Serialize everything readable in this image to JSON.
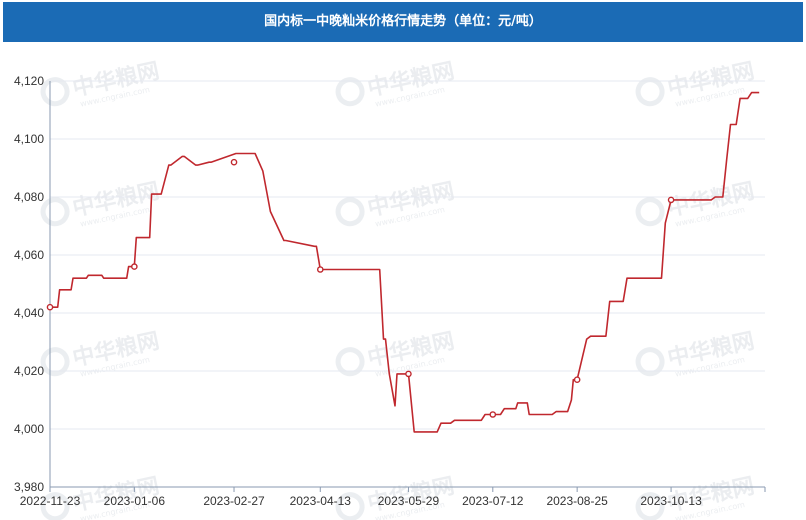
{
  "header": {
    "title": "国内标一中晚籼米价格行情走势（单位：元/吨）"
  },
  "watermark": {
    "brand": "中华粮网",
    "site": "www.cngrain.com"
  },
  "colors": {
    "header_bg": "#1b6bb5",
    "line": "#c0282e",
    "grid": "#e4e8f0",
    "axis": "#8a9ab0"
  },
  "chart_data": {
    "type": "line",
    "title": "国内标一中晚籼米价格行情走势（单位：元/吨）",
    "xlabel": "",
    "ylabel": "",
    "xlim": [
      "2022-11-23",
      "2023-12-01"
    ],
    "ylim": [
      3980,
      4120
    ],
    "yticks": [
      3980,
      4000,
      4020,
      4040,
      4060,
      4080,
      4100,
      4120
    ],
    "yticks_label": [
      "3,980",
      "4,000",
      "4,020",
      "4,040",
      "4,060",
      "4,080",
      "4,100",
      "4,120"
    ],
    "xticks": [
      "2022-11-23",
      "2023-01-06",
      "2023-02-27",
      "2023-04-13",
      "2023-05-29",
      "2023-07-12",
      "2023-08-25",
      "2023-10-13"
    ],
    "grid": "horizontal",
    "series": [
      {
        "name": "",
        "x": [
          "2022-11-23",
          "2022-11-27",
          "2022-11-28",
          "2022-12-04",
          "2022-12-05",
          "2022-12-12",
          "2022-12-13",
          "2022-12-20",
          "2022-12-21",
          "2023-01-02",
          "2023-01-03",
          "2023-01-05",
          "2023-01-06",
          "2023-01-07",
          "2023-01-14",
          "2023-01-15",
          "2023-01-20",
          "2023-01-24",
          "2023-01-25",
          "2023-01-31",
          "2023-02-01",
          "2023-02-07",
          "2023-02-08",
          "2023-02-14",
          "2023-02-15",
          "2023-02-28",
          "2023-03-02",
          "2023-03-10",
          "2023-03-14",
          "2023-03-18",
          "2023-03-25",
          "2023-03-26",
          "2023-04-10",
          "2023-04-11",
          "2023-04-13",
          "2023-04-14",
          "2023-05-14",
          "2023-05-16",
          "2023-05-17",
          "2023-05-19",
          "2023-05-22",
          "2023-05-23",
          "2023-05-28",
          "2023-05-29",
          "2023-06-01",
          "2023-06-02",
          "2023-06-13",
          "2023-06-15",
          "2023-06-20",
          "2023-06-22",
          "2023-07-06",
          "2023-07-08",
          "2023-07-16",
          "2023-07-18",
          "2023-07-24",
          "2023-07-25",
          "2023-07-30",
          "2023-07-31",
          "2023-08-06",
          "2023-08-12",
          "2023-08-14",
          "2023-08-20",
          "2023-08-22",
          "2023-08-23",
          "2023-08-25",
          "2023-08-30",
          "2023-09-01",
          "2023-09-09",
          "2023-09-11",
          "2023-09-18",
          "2023-09-20",
          "2023-10-08",
          "2023-10-10",
          "2023-10-13",
          "2023-11-03",
          "2023-11-05",
          "2023-11-09",
          "2023-11-11",
          "2023-11-13",
          "2023-11-16",
          "2023-11-18",
          "2023-11-22",
          "2023-11-24",
          "2023-11-28"
        ],
        "values": [
          4042,
          4042,
          4048,
          4048,
          4052,
          4052,
          4053,
          4053,
          4052,
          4052,
          4056,
          4056,
          4056,
          4066,
          4066,
          4081,
          4081,
          4091,
          4091,
          4094,
          4094,
          4091,
          4091,
          4092,
          4092,
          4095,
          4095,
          4095,
          4089,
          4075,
          4065,
          4065,
          4063,
          4063,
          4055,
          4055,
          4055,
          4031,
          4031,
          4019,
          4008,
          4019,
          4019,
          4019,
          3999,
          3999,
          3999,
          4002,
          4002,
          4003,
          4003,
          4005,
          4005,
          4007,
          4007,
          4009,
          4009,
          4005,
          4005,
          4005,
          4006,
          4006,
          4010,
          4017,
          4017,
          4031,
          4032,
          4032,
          4044,
          4044,
          4052,
          4052,
          4071,
          4079,
          4079,
          4080,
          4080,
          4093,
          4105,
          4105,
          4114,
          4114,
          4116,
          4116
        ]
      }
    ],
    "markers": {
      "x": [
        "2022-11-23",
        "2023-01-06",
        "2023-02-27",
        "2023-04-13",
        "2023-05-29",
        "2023-07-12",
        "2023-08-25",
        "2023-10-13"
      ],
      "values": [
        4042,
        4056,
        4092,
        4055,
        4019,
        4005,
        4017,
        4079
      ]
    }
  }
}
